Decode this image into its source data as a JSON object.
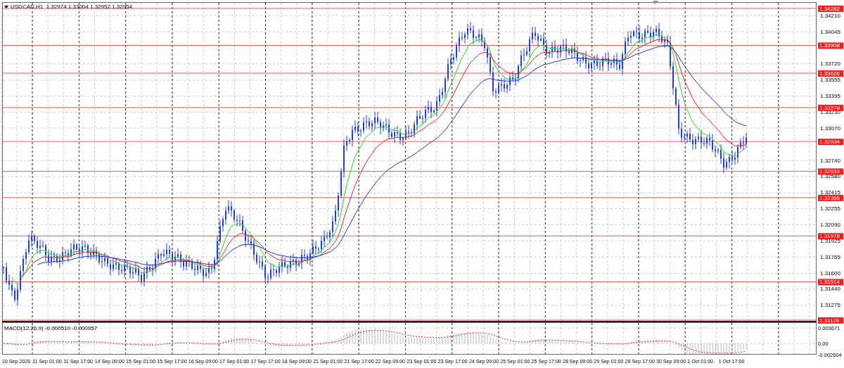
{
  "chart": {
    "title": "USDCAD,H1  1.32974 1.33004 1.32952 1.32954",
    "price_ticks": [
      "1.34210",
      "1.34045",
      "1.33720",
      "1.33555",
      "1.33395",
      "1.33230",
      "1.33070",
      "1.32740",
      "1.32580",
      "1.32415",
      "1.32255",
      "1.32090",
      "1.31925",
      "1.31765",
      "1.31600",
      "1.31440",
      "1.31275"
    ],
    "levels": [
      "1.34282",
      "1.33908",
      "1.33626",
      "1.33278",
      "1.32934",
      "1.32633",
      "1.32366",
      "1.31978",
      "1.31514",
      "1.31126"
    ],
    "time_labels": [
      "10 Sep 2020",
      "11 Sep 01:00",
      "11 Sep 17:00",
      "14 Sep 09:00",
      "15 Sep 01:00",
      "15 Sep 17:00",
      "16 Sep 09:00",
      "17 Sep 01:00",
      "17 Sep 17:00",
      "18 Sep 09:00",
      "21 Sep 01:00",
      "21 Sep 17:00",
      "22 Sep 09:00",
      "23 Sep 01:00",
      "23 Sep 17:00",
      "24 Sep 09:00",
      "25 Sep 01:00",
      "25 Sep 17:00",
      "28 Sep 09:00",
      "29 Sep 01:00",
      "29 Sep 17:00",
      "30 Sep 09:00",
      "1 Oct 01:00",
      "1 Oct 17:00"
    ]
  },
  "macd": {
    "label": "MACD(12,26,9) -0.000510 -0.000957",
    "axis": [
      "0.003671",
      "0.00",
      "-0.002604"
    ]
  }
}
